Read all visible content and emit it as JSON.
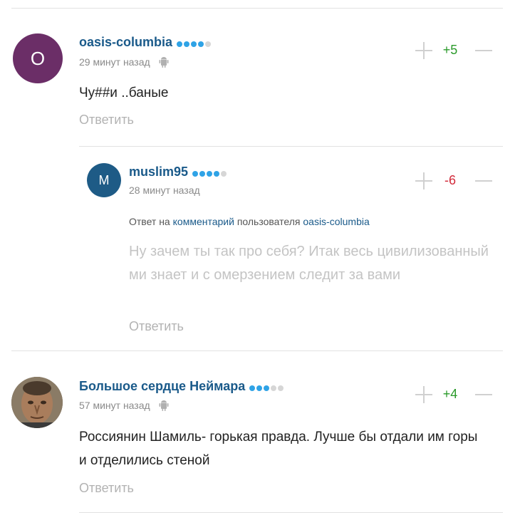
{
  "comments": [
    {
      "avatar_letter": "O",
      "avatar_color": "#6b2e67",
      "username": "oasis-columbia",
      "rating_dots": [
        1,
        1,
        1,
        1,
        0
      ],
      "time": "29 минут назад",
      "device_icon": "android-icon",
      "text": "Чу##и ..баные",
      "reply_label": "Ответить",
      "score": "+5",
      "score_sign": "positive"
    },
    {
      "avatar_letter": "M",
      "avatar_color": "#1e5b86",
      "username": "muslim95",
      "rating_dots": [
        1,
        1,
        1,
        1,
        0
      ],
      "time": "28 минут назад",
      "answer_prefix": "Ответ на",
      "answer_link": "комментарий",
      "answer_middle": "пользователя",
      "answer_user": "oasis-columbia",
      "text": "Ну зачем ты так про себя? Итак весь цивилизованный ми знает и с омерзением следит за вами",
      "reply_label": "Ответить",
      "score": "-6",
      "score_sign": "negative"
    },
    {
      "avatar_type": "photo",
      "username": "Большое сердце Неймара",
      "rating_dots": [
        1,
        1,
        1,
        0,
        0
      ],
      "time": "57 минут назад",
      "device_icon": "android-icon",
      "text": "Россиянин Шамиль- горькая правда. Лучше бы отдали им горы и отделились стеной",
      "reply_label": "Ответить",
      "score": "+4",
      "score_sign": "positive"
    }
  ],
  "colors": {
    "username": "#1a5a8a",
    "dot_on": "#2fa3e6",
    "dot_off": "#d6d6d6",
    "score_positive": "#2a9a2a",
    "score_negative": "#d22a3a"
  }
}
